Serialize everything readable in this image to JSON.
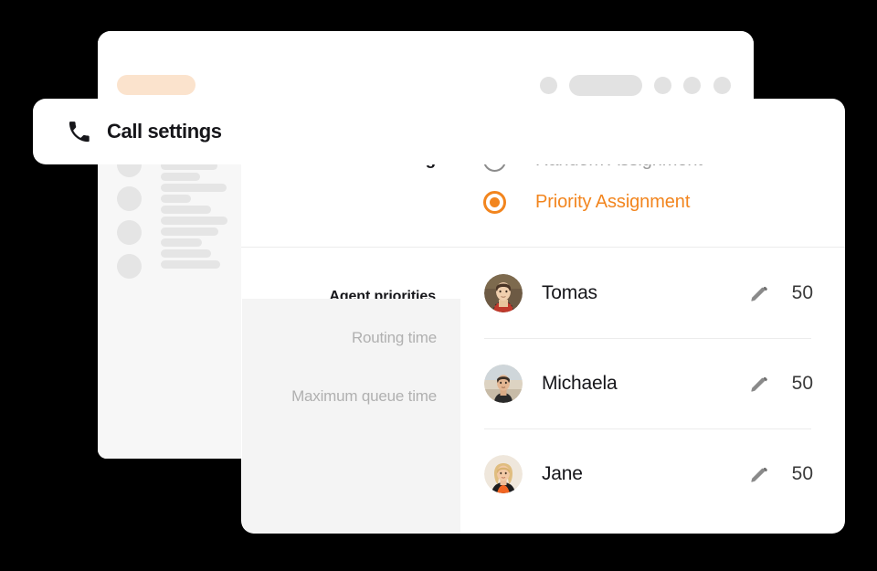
{
  "window": {
    "chrome": {
      "tab_pill": "active-tab-placeholder",
      "controls": [
        "dot",
        "pill",
        "dot",
        "dot",
        "dot"
      ]
    },
    "sidebar": {
      "placeholder_items": 4
    }
  },
  "overlay_card": {
    "icon": "phone-icon",
    "title": "Call settings"
  },
  "call_routing": {
    "label": "Call routing",
    "options": [
      {
        "label": "Random Assignment",
        "selected": false
      },
      {
        "label": "Priority Assignment",
        "selected": true
      }
    ]
  },
  "agent_priorities": {
    "label": "Agent priorities",
    "edit_icon": "pencil-icon",
    "agents": [
      {
        "name": "Tomas",
        "priority": "50",
        "avatar": "avatar-tomas"
      },
      {
        "name": "Michaela",
        "priority": "50",
        "avatar": "avatar-michaela"
      },
      {
        "name": "Jane",
        "priority": "50",
        "avatar": "avatar-jane"
      }
    ]
  },
  "timing_settings": {
    "routing_time_label": "Routing time",
    "maximum_queue_time_label": "Maximum queue time"
  },
  "colors": {
    "accent": "#f2851e",
    "accent_soft": "#fbe3cd",
    "text": "#16161a",
    "muted": "#9a9a9a",
    "panel": "#f4f4f4",
    "divider": "#ececec",
    "skeleton": "#e5e5e5"
  }
}
